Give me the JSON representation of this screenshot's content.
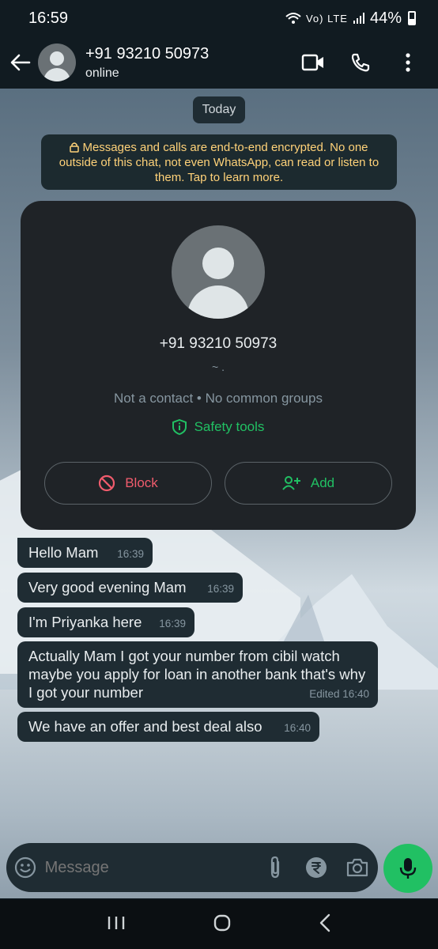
{
  "status_bar": {
    "time": "16:59",
    "network": "Vo) LTE",
    "battery": "44%"
  },
  "header": {
    "contact_name": "+91 93210 50973",
    "status": "online"
  },
  "chat": {
    "date_chip": "Today",
    "encryption_notice": "Messages and calls are end-to-end encrypted. No one outside of this chat, not even WhatsApp, can read or listen to them. Tap to learn more.",
    "contact_card": {
      "number": "+91 93210 50973",
      "about": "~ .",
      "meta": "Not a contact • No common groups",
      "safety_label": "Safety tools",
      "block_label": "Block",
      "add_label": "Add"
    },
    "messages": [
      {
        "text": "Hello Mam",
        "time": "16:39"
      },
      {
        "text": "Very good evening Mam",
        "time": "16:39"
      },
      {
        "text": "I'm Priyanka here",
        "time": "16:39"
      },
      {
        "text": "Actually Mam I got your number from cibil watch maybe you apply for loan in another bank that's why I got your number",
        "time": "Edited  16:40"
      },
      {
        "text": "We have an offer and best deal also",
        "time": "16:40"
      }
    ]
  },
  "composer": {
    "placeholder": "Message"
  },
  "colors": {
    "accent": "#21c063",
    "block": "#f15c6d",
    "notice": "#ffd279",
    "bubble": "#1f2c33"
  },
  "icons": [
    "back-arrow-icon",
    "video-call-icon",
    "voice-call-icon",
    "more-options-icon",
    "lock-icon",
    "shield-icon",
    "block-icon",
    "add-person-icon",
    "emoji-icon",
    "attach-icon",
    "rupee-icon",
    "camera-icon",
    "mic-icon",
    "recents-icon",
    "home-icon",
    "back-icon"
  ]
}
